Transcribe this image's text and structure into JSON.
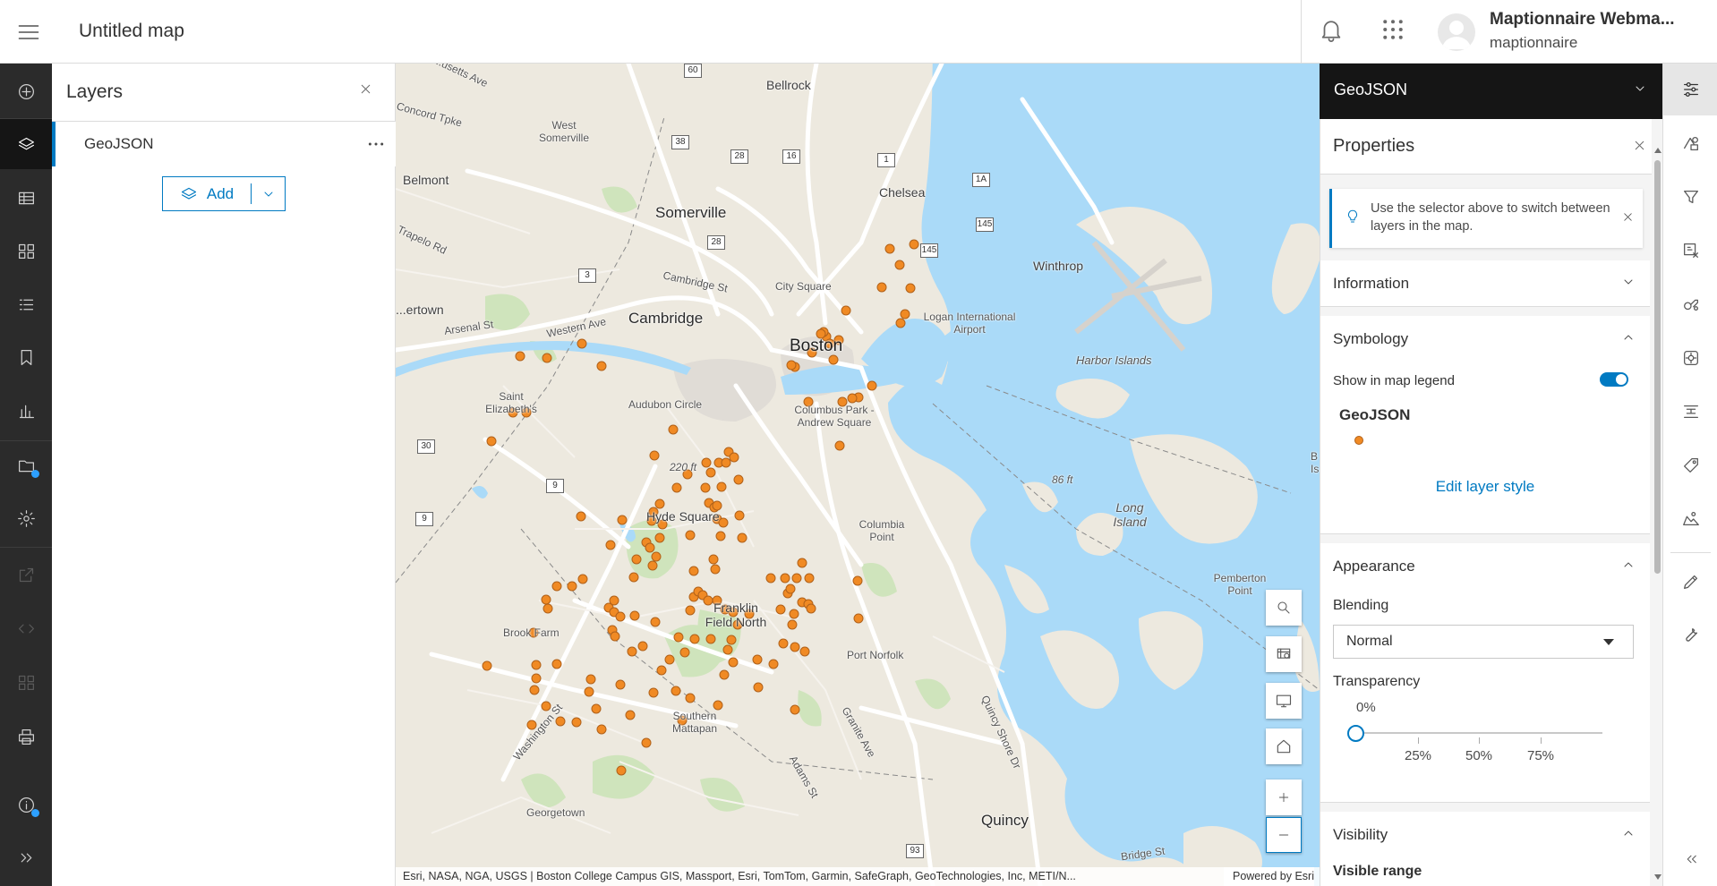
{
  "header": {
    "map_title": "Untitled map",
    "user_name": "Maptionnaire Webma...",
    "user_org": "maptionnaire",
    "icons": [
      "hamburger-icon",
      "bell-icon",
      "apps-grid-icon",
      "avatar"
    ]
  },
  "left_nav": {
    "items": [
      "add",
      "layers",
      "tables",
      "basemap",
      "legend",
      "bookmarks",
      "charts",
      "sketch",
      "settings",
      "share",
      "embed",
      "apps",
      "print",
      "info",
      "expand"
    ],
    "notification_color": "#2da0ff"
  },
  "layers_panel": {
    "title": "Layers",
    "layer_name": "GeoJSON",
    "add_label": "Add"
  },
  "map": {
    "labels": {
      "massachusetts": "...usetts Ave",
      "bellrock": "Bellrock",
      "west_somerville": "West Somerville",
      "concord": "Concord Tpke",
      "belmont": "Belmont",
      "somerville": "Somerville",
      "chelsea": "Chelsea",
      "winthrop": "Winthrop",
      "trapelo": "Trapelo Rd",
      "cambridge_st": "Cambridge St",
      "city_square": "City Square",
      "logan": "Logan International Airport",
      "watertown": "...ertown",
      "arsenal": "Arsenal St",
      "western_ave": "Western Ave",
      "cambridge": "Cambridge",
      "boston": "Boston",
      "harbor_islands": "Harbor Islands",
      "saint_elizabeths": "Saint Elizabeth's",
      "audubon": "Audubon Circle",
      "columbus": "Columbus Park - Andrew Square",
      "elev220": "220 ft",
      "elev86": "86 ft",
      "long_island": "Long Island",
      "hyde_square": "Hyde Square",
      "columbia_point": "Columbia Point",
      "pemberton": "Pemberton Point",
      "franklin": "Franklin Field North",
      "brook_farm": "Brook Farm",
      "port_norfolk": "Port Norfolk",
      "southern_mattapan": "Southern Mattapan",
      "washington_st": "Washington St",
      "granite_ave": "Granite Ave",
      "quincy_shore": "Quincy Shore Dr",
      "adams_st": "Adams St",
      "georgetown": "Georgetown",
      "quincy": "Quincy",
      "bridge_st": "Bridge St",
      "edge_is": "B Is"
    },
    "shields": [
      "60",
      "38",
      "28",
      "16",
      "1",
      "1A",
      "145",
      "145",
      "28",
      "3",
      "30",
      "9",
      "9",
      "93"
    ],
    "attribution": "Esri, NASA, NGA, USGS | Boston College Campus GIS, Massport, Esri, TomTom, Garmin, SafeGraph, GeoTechnologies, Inc, METI/N...",
    "powered_by": "Powered by Esri",
    "point_color": "#f08a24",
    "controls": [
      "search",
      "basemap",
      "fullscreen",
      "home",
      "zoom-in",
      "zoom-out"
    ]
  },
  "properties_panel": {
    "layer_selector": "GeoJSON",
    "title": "Properties",
    "notice": "Use the selector above to switch between layers in the map.",
    "information": "Information",
    "symbology": {
      "title": "Symbology",
      "show_in_legend_label": "Show in map legend",
      "show_in_legend": true,
      "layer_name": "GeoJSON",
      "edit_style": "Edit layer style"
    },
    "appearance": {
      "title": "Appearance",
      "blending_label": "Blending",
      "blending_value": "Normal",
      "transparency_label": "Transparency",
      "transparency_value": "0%",
      "transparency_fraction": 0,
      "ticks": [
        "25%",
        "50%",
        "75%"
      ]
    },
    "visibility": {
      "title": "Visibility",
      "visible_range": "Visible range"
    }
  },
  "right_nav": {
    "items": [
      "properties",
      "styles",
      "filter",
      "effects",
      "configure-popups",
      "configure-clusters",
      "labels",
      "fields",
      "map-tools",
      "sketch-tools",
      "measure",
      "collapse"
    ]
  },
  "colors": {
    "accent": "#007ac2",
    "dark_nav": "#2b2b2b",
    "water": "#aadaf8"
  }
}
